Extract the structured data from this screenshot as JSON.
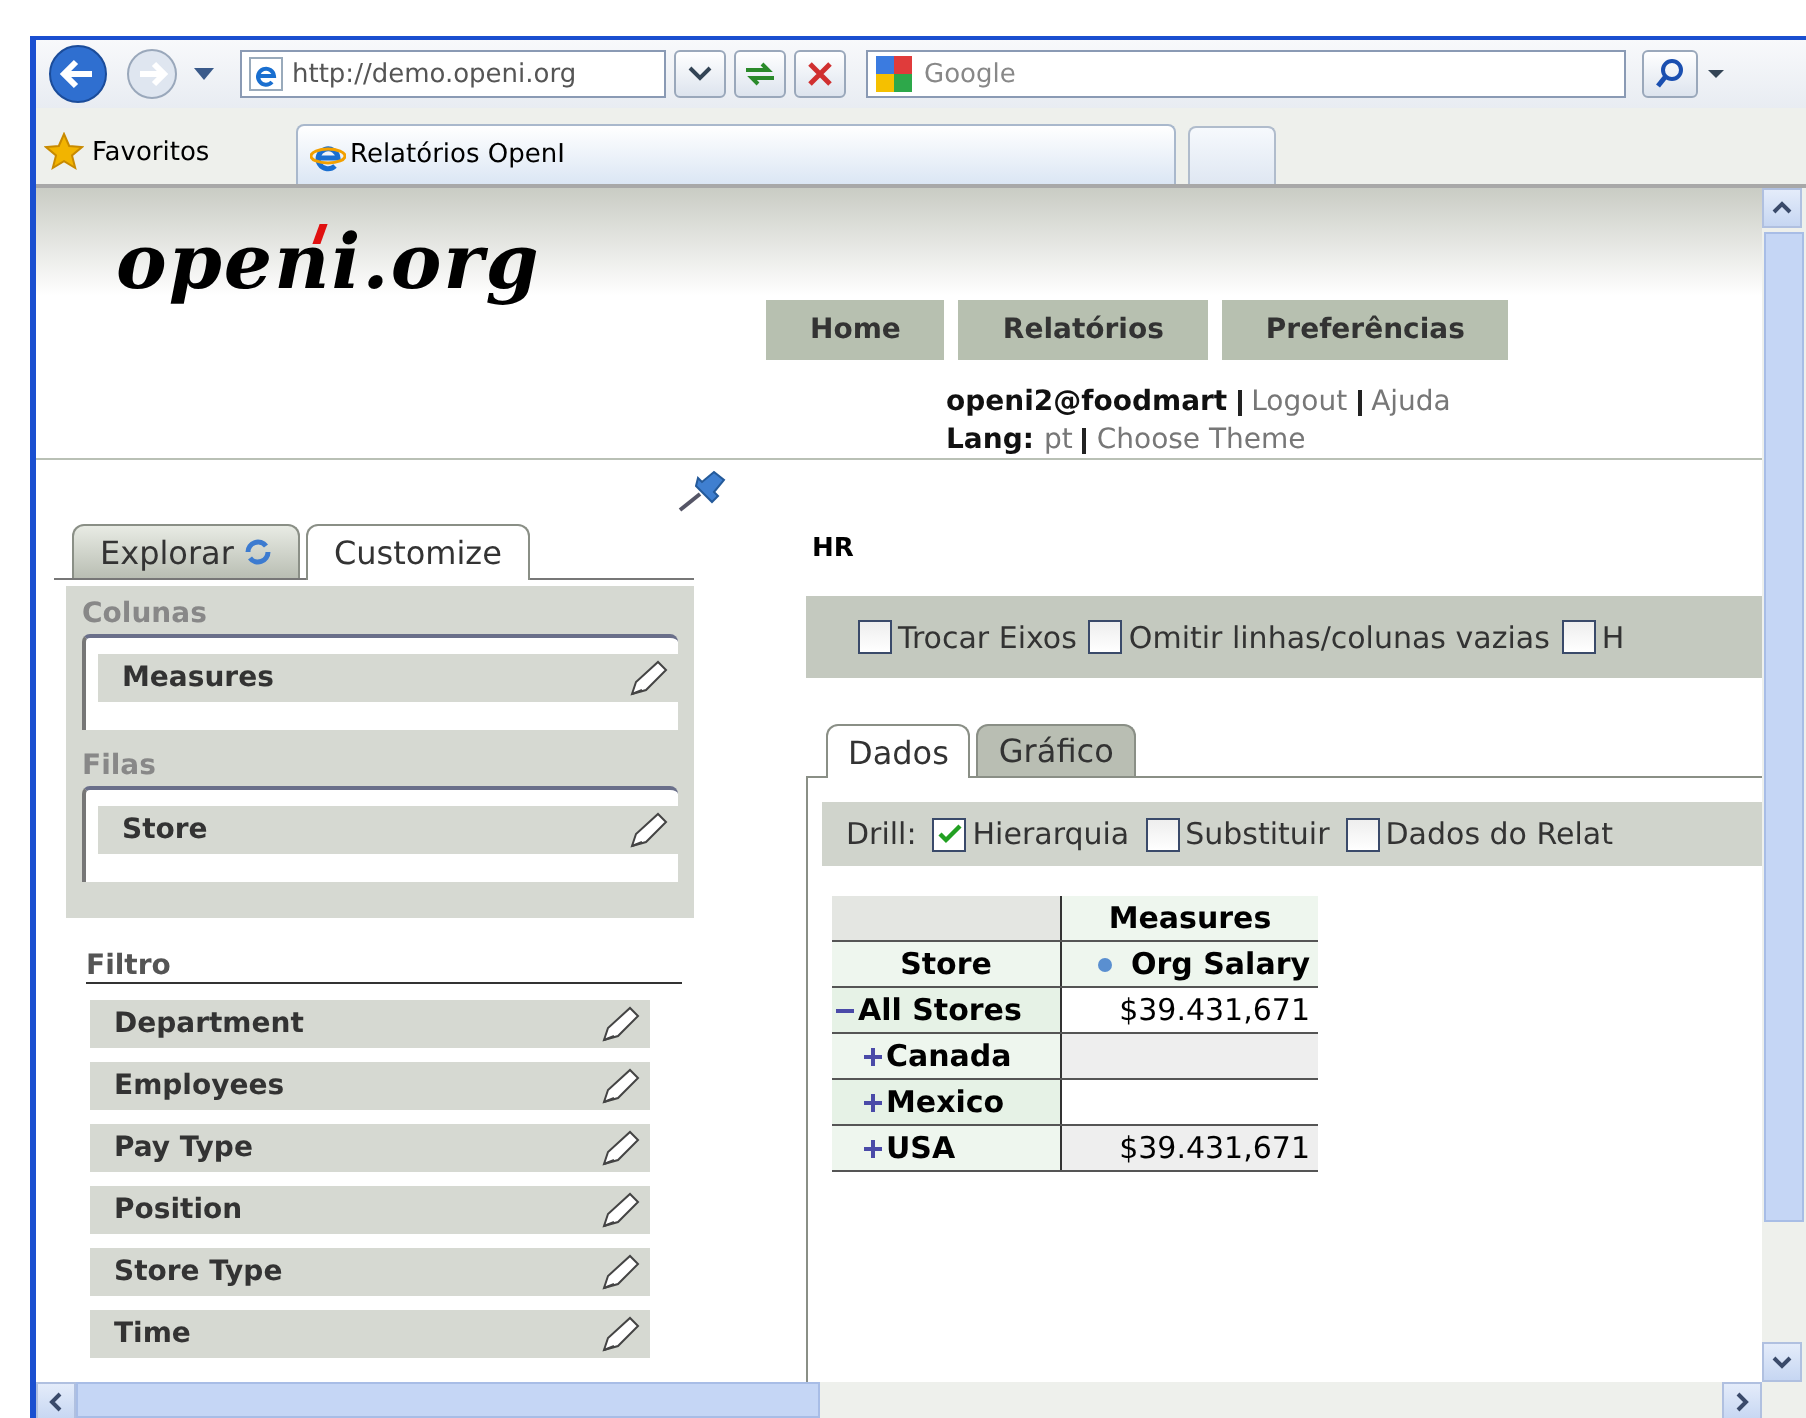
{
  "browser": {
    "address": "http://demo.openi.org",
    "search_placeholder": "Google",
    "favorites": "Favoritos",
    "tab_title": "Relatórios OpenI"
  },
  "header": {
    "logo": "openi.org",
    "nav": [
      "Home",
      "Relatórios",
      "Preferências"
    ],
    "user": "openi2@foodmart",
    "logout": "Logout",
    "help": "Ajuda",
    "lang_label": "Lang:",
    "lang": "pt",
    "theme": "Choose Theme"
  },
  "sidebar": {
    "tabs": [
      {
        "label": "Explorar",
        "selected": false
      },
      {
        "label": "Customize",
        "selected": true
      }
    ],
    "columns_title": "Colunas",
    "columns": [
      "Measures"
    ],
    "rows_title": "Filas",
    "rows": [
      "Store"
    ],
    "filter_title": "Filtro",
    "filters": [
      "Department",
      "Employees",
      "Pay Type",
      "Position",
      "Store Type",
      "Time"
    ]
  },
  "report": {
    "title": "HR",
    "options": [
      {
        "label": "Trocar Eixos",
        "checked": false
      },
      {
        "label": "Omitir linhas/colunas vazias",
        "checked": false
      },
      {
        "label": "H",
        "checked": false
      }
    ],
    "tabs": [
      {
        "label": "Dados",
        "selected": true
      },
      {
        "label": "Gráfico",
        "selected": false
      }
    ],
    "drill_label": "Drill:",
    "drill": [
      {
        "label": "Hierarquia",
        "checked": true
      },
      {
        "label": "Substituir",
        "checked": false
      },
      {
        "label": "Dados do Relat",
        "checked": false
      }
    ],
    "table": {
      "measures_header": "Measures",
      "row_header": "Store",
      "column": "Org Salary",
      "rows": [
        {
          "label": "All Stores",
          "expanded": true,
          "value": "$39.431,671",
          "children": [
            {
              "label": "Canada",
              "expanded": false
            },
            {
              "label": "Mexico",
              "expanded": false
            },
            {
              "label": "USA",
              "expanded": false,
              "value": "$39.431,671"
            }
          ]
        }
      ]
    }
  }
}
